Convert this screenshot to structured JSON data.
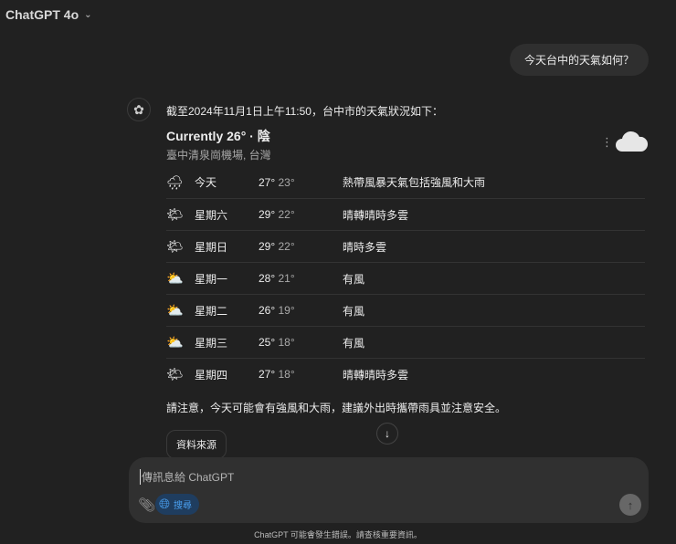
{
  "header": {
    "model": "ChatGPT 4o"
  },
  "user_message": "今天台中的天氣如何？",
  "assistant": {
    "intro": "截至2024年11月1日上午11:50，台中市的天氣狀況如下：",
    "current": "Currently 26° · 陰",
    "location": "臺中清泉崗機場, 台灣",
    "forecast": [
      {
        "icon": "🌧",
        "day": "今天",
        "hi": "27°",
        "lo": "23°",
        "desc": "熱帶風暴天氣包括強風和大雨"
      },
      {
        "icon": "🌤",
        "day": "星期六",
        "hi": "29°",
        "lo": "22°",
        "desc": "晴轉晴時多雲"
      },
      {
        "icon": "🌤",
        "day": "星期日",
        "hi": "29°",
        "lo": "22°",
        "desc": "晴時多雲"
      },
      {
        "icon": "⛅",
        "day": "星期一",
        "hi": "28°",
        "lo": "21°",
        "desc": "有風"
      },
      {
        "icon": "⛅",
        "day": "星期二",
        "hi": "26°",
        "lo": "19°",
        "desc": "有風"
      },
      {
        "icon": "⛅",
        "day": "星期三",
        "hi": "25°",
        "lo": "18°",
        "desc": "有風"
      },
      {
        "icon": "🌤",
        "day": "星期四",
        "hi": "27°",
        "lo": "18°",
        "desc": "晴轉晴時多雲"
      }
    ],
    "note": "請注意，今天可能會有強風和大雨，建議外出時攜帶雨具並注意安全。",
    "sources_label": "資料來源"
  },
  "composer": {
    "placeholder": "傳訊息給 ChatGPT",
    "search_label": "搜尋"
  },
  "footer": "ChatGPT 可能會發生錯誤。請查核重要資訊。"
}
